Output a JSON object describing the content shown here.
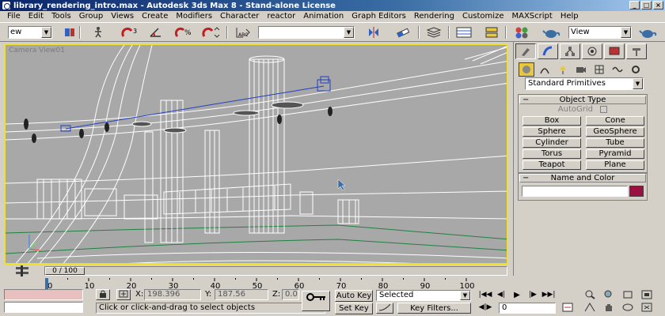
{
  "window": {
    "title": "library_rendering_intro.max - Autodesk 3ds Max 8 - Stand-alone License",
    "buttons": [
      "_",
      "□",
      "×"
    ]
  },
  "menu": [
    "File",
    "Edit",
    "Tools",
    "Group",
    "Views",
    "Create",
    "Modifiers",
    "Character",
    "reactor",
    "Animation",
    "Graph Editors",
    "Rendering",
    "Customize",
    "MAXScript",
    "Help"
  ],
  "toolbar": {
    "undo_combo": "ew",
    "named_selection": "",
    "render_view": "View"
  },
  "viewport": {
    "label": "Camera View01",
    "border_color": "#f0e22a",
    "bg_color": "#a8a8a8"
  },
  "command_panel": {
    "primitive_type": "Standard Primitives",
    "object_type_title": "Object Type",
    "autogrid_label": "AutoGrid",
    "objects": [
      "Box",
      "Cone",
      "Sphere",
      "GeoSphere",
      "Cylinder",
      "Tube",
      "Torus",
      "Pyramid",
      "Teapot",
      "Plane"
    ],
    "name_color_title": "Name and Color",
    "name_value": "",
    "object_color": "#9a1040"
  },
  "time_slider": {
    "frame_label": "0 / 100",
    "current_frame": 0,
    "total_frames": 100,
    "ticks": [
      "0",
      "10",
      "20",
      "30",
      "40",
      "50",
      "60",
      "70",
      "80",
      "90",
      "100"
    ]
  },
  "status": {
    "prompt": "Click or click-and-drag to select objects",
    "x_label": "X:",
    "x_value": "198.396",
    "y_label": "Y:",
    "y_value": "187.56",
    "z_label": "Z:",
    "z_value": "0.0",
    "auto_key": "Auto Key",
    "set_key": "Set Key",
    "key_mode": "Selected",
    "key_filters": "Key Filters...",
    "frame_field": "0"
  }
}
